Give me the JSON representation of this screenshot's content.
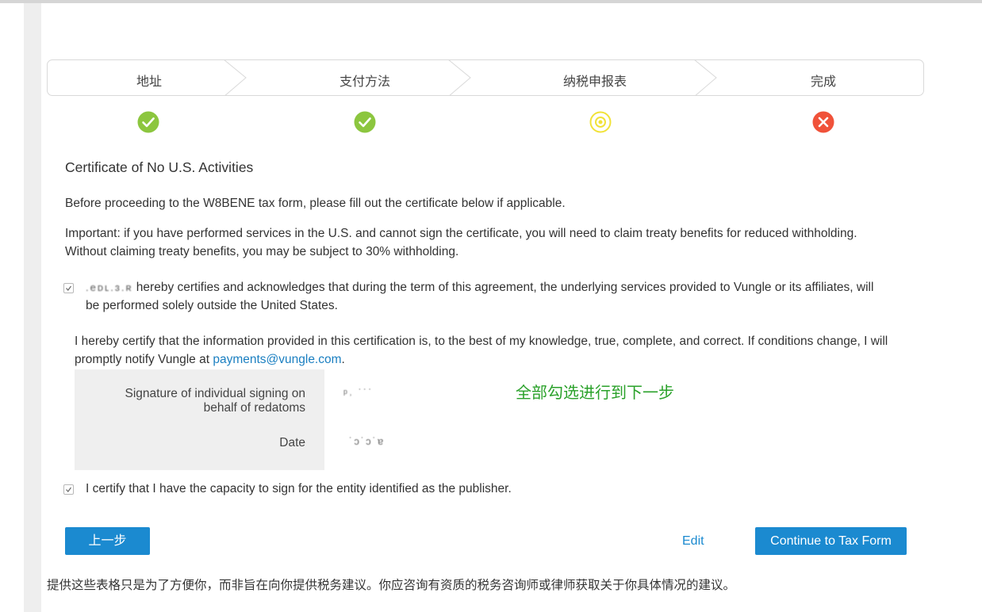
{
  "steps": [
    {
      "label": "地址",
      "status": "complete",
      "status_color": "#8cc63f"
    },
    {
      "label": "支付方法",
      "status": "complete",
      "status_color": "#8cc63f"
    },
    {
      "label": "纳税申报表",
      "status": "in-progress",
      "status_color": "#f1e238"
    },
    {
      "label": "完成",
      "status": "error",
      "status_color": "#f0523a"
    }
  ],
  "form": {
    "title": "Certificate of No U.S. Activities",
    "intro": "Before proceeding to the W8BENE tax form, please fill out the certificate below if applicable.",
    "important": "Important: if you have performed services in the U.S. and cannot sign the certificate, you will need to claim treaty benefits for reduced withholding. Without claiming treaty benefits, you may be subject to 30% withholding.",
    "certify_checkbox": {
      "checked": true,
      "name_redacted": ".eᴅʟ.ɜ.ʀ",
      "text": "hereby certifies and acknowledges that during the term of this agreement, the underlying services provided to Vungle or its affiliates, will be performed solely outside the United States."
    },
    "certify_info_text": "I hereby certify that the information provided in this certification is, to the best of my knowledge, true, complete, and correct. If conditions change, I will promptly notify Vungle at",
    "email_link": "payments@vungle.com",
    "period": ".",
    "signature_label": "Signature of individual signing on behalf of redatoms",
    "signature_value": "ᵖ˒ ˙˙˙",
    "date_label": "Date",
    "date_value": "˙ɔ˙ɔ˙ɐ",
    "capacity_checkbox": {
      "checked": true,
      "text": "I certify that I have the capacity to sign for the entity identified as the publisher."
    }
  },
  "annotation": "全部勾选进行到下一步",
  "buttons": {
    "back": "上一步",
    "edit": "Edit",
    "continue": "Continue to Tax Form"
  },
  "footer": "提供这些表格只是为了方便你，而非旨在向你提供税务建议。你应咨询有资质的税务咨询师或律师获取关于你具体情况的建议。",
  "colors": {
    "accent": "#1b8ad0",
    "link": "#1a7fc1",
    "annotation": "#2aa12a"
  }
}
